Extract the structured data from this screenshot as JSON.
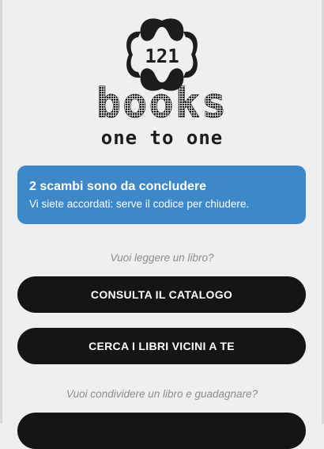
{
  "logo": {
    "badge_text": "121",
    "wordmark": "books",
    "tagline": "one to one"
  },
  "banner": {
    "title": "2 scambi sono da concludere",
    "text": "Vi siete accordati: serve il codice per chiudere.",
    "color": "#3c88c9"
  },
  "read_section": {
    "prompt": "Vuoi leggere un libro?",
    "catalog_button": "CONSULTA IL CATALOGO",
    "nearby_button": "CERCA I LIBRI VICINI A TE"
  },
  "share_section": {
    "prompt": "Vuoi condividere un libro e guadagnare?"
  },
  "colors": {
    "background": "#efefef",
    "button": "#151515",
    "prompt_text": "#8d8d8d"
  }
}
